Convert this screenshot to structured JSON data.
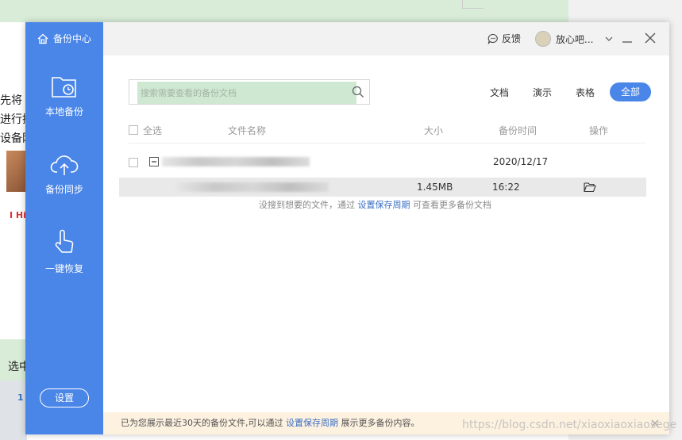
{
  "background": {
    "lines": [
      "先将",
      "进行操",
      "设备网"
    ],
    "red_text": "I Hi",
    "bottom_text": "选中",
    "bottom_label": "1"
  },
  "sidebar": {
    "brand": "备份中心",
    "items": [
      {
        "label": "本地备份",
        "icon": "folder-clock-icon"
      },
      {
        "label": "备份同步",
        "icon": "cloud-upload-icon"
      },
      {
        "label": "一键恢复",
        "icon": "hand-pointer-icon"
      }
    ],
    "settings_label": "设置"
  },
  "topbar": {
    "feedback_label": "反馈",
    "user_name": "放心吧...",
    "user_icon": "chevron-down-icon"
  },
  "search": {
    "placeholder": "搜索需要查看的备份文档"
  },
  "filters": [
    "文档",
    "演示",
    "表格",
    "全部"
  ],
  "active_filter": "全部",
  "table": {
    "select_all": "全选",
    "headers": {
      "name": "文件名称",
      "size": "大小",
      "time": "备份时间",
      "action": "操作"
    },
    "group": {
      "date": "2020/12/17"
    },
    "rows": [
      {
        "size": "1.45MB",
        "time": "16:22",
        "action_icon": "folder-open-icon"
      }
    ]
  },
  "hint": {
    "prefix": "没搜到想要的文件，通过",
    "link": "设置保存周期",
    "suffix": "可查看更多备份文档"
  },
  "footer": {
    "prefix": "已为您展示最近30天的备份文件,可以通过",
    "link": "设置保存周期",
    "suffix": "展示更多备份内容。"
  },
  "watermark": "https://blog.csdn.net/xiaoxiaoxiaosege",
  "colors": {
    "accent": "#4a86e8",
    "link": "#3a6fc4",
    "footer_bg": "#fdf1e0"
  }
}
